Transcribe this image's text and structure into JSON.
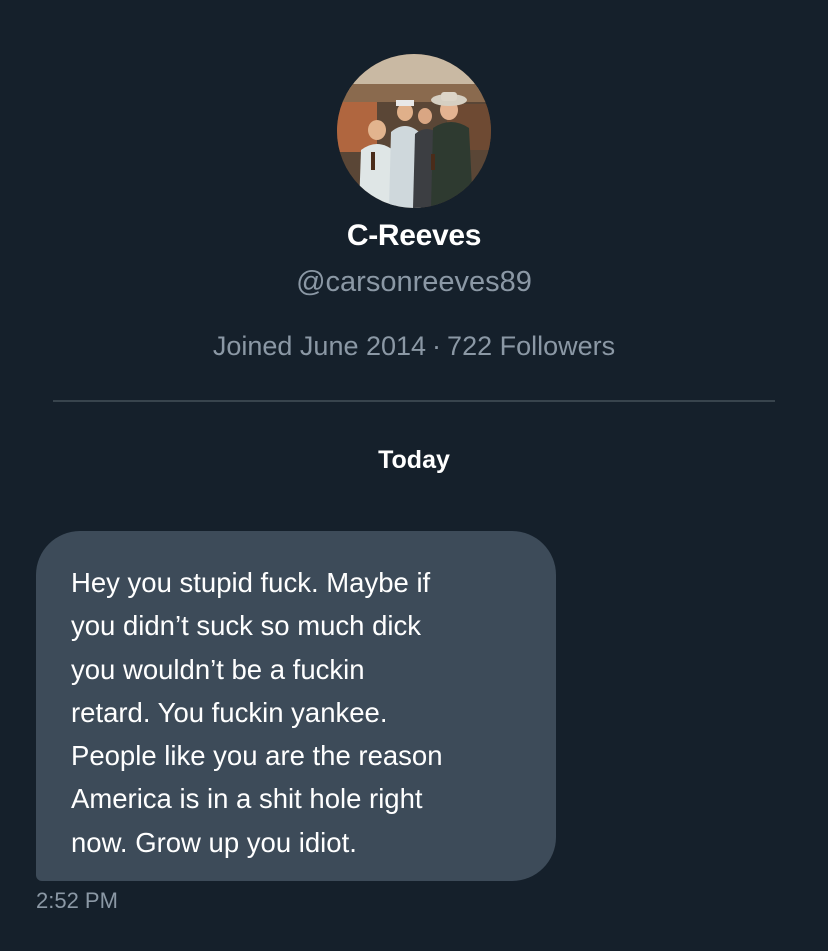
{
  "profile": {
    "display_name": "C-Reeves",
    "handle": "@carsonreeves89",
    "joined": "Joined June 2014",
    "separator": "·",
    "followers": "722 Followers"
  },
  "conversation": {
    "day_label": "Today",
    "messages": [
      {
        "text": "Hey you stupid fuck. Maybe if\nyou didn’t suck so much dick\nyou wouldn’t be a fuckin\nretard. You fuckin yankee.\nPeople like you are the reason\nAmerica is in a shit hole right\nnow. Grow up you idiot.",
        "time": "2:52 PM"
      }
    ]
  },
  "colors": {
    "background": "#15202b",
    "bubble": "#3d4b59",
    "secondary_text": "#8b98a5",
    "divider": "#38444d"
  }
}
